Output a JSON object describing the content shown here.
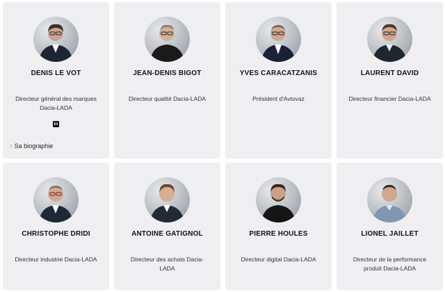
{
  "people": [
    {
      "name": "DENIS LE VOT",
      "title": "Directeur général des marques Dacia-LADA",
      "linkedin": "in",
      "bio": "Sa biographie"
    },
    {
      "name": "JEAN-DENIS BIGOT",
      "title": "Directeur qualité Dacia-LADA"
    },
    {
      "name": "YVES CARACATZANIS",
      "title": "Président d'Avtovaz"
    },
    {
      "name": "LAURENT DAVID",
      "title": "Directeur financier Dacia-LADA"
    },
    {
      "name": "CHRISTOPHE DRIDI",
      "title": "Directeur industrie Dacia-LADA"
    },
    {
      "name": "ANTOINE GATIGNOL",
      "title": "Directeur des achats Dacia-LADA"
    },
    {
      "name": "PIERRE HOULES",
      "title": "Directeur digital Dacia-LADA"
    },
    {
      "name": "LIONEL JAILLET",
      "title": "Directeur de la performance produit Dacia-LADA"
    }
  ],
  "colors": {
    "card_bg": "#efeff1",
    "chevron": "#e0a020"
  }
}
